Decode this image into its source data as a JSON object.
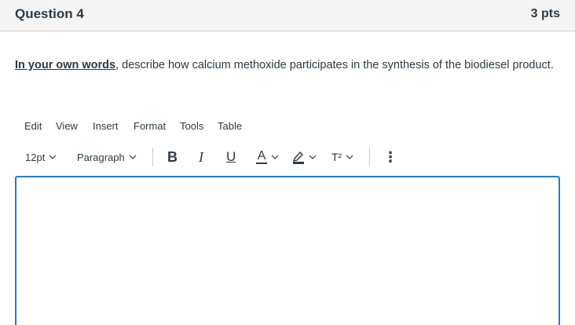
{
  "question": {
    "title": "Question 4",
    "points": "3 pts"
  },
  "prompt": {
    "emphasis": "In your own words",
    "text": ", describe how calcium methoxide participates in the synthesis of the biodiesel product."
  },
  "menubar": [
    "Edit",
    "View",
    "Insert",
    "Format",
    "Tools",
    "Table"
  ],
  "toolbar": {
    "font_size": "12pt",
    "block_format": "Paragraph",
    "bold_label": "B",
    "italic_label": "I",
    "underline_label": "U",
    "text_color_label": "A",
    "superscript_label": "T²",
    "more_label": "⋮",
    "text_color": "#2d3b45",
    "highlight_color": "#2d3b45"
  },
  "editor": {
    "value": ""
  },
  "colors": {
    "accent": "#2b7abc",
    "text": "#2d3b45",
    "header_bg": "#f5f5f5"
  }
}
